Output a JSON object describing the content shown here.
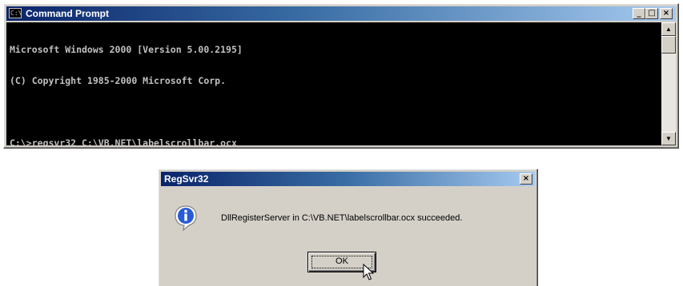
{
  "cmd_window": {
    "title": "Command Prompt",
    "title_icon_text": "C:\\",
    "buttons": {
      "minimize": "_",
      "maximize": "□",
      "close": "×"
    },
    "console_lines": [
      "Microsoft Windows 2000 [Version 5.00.2195]",
      "(C) Copyright 1985-2000 Microsoft Corp.",
      "",
      "C:\\>regsvr32 C:\\VB.NET\\labelscrollbar.ocx"
    ],
    "scrollbar": {
      "up_arrow": "▲",
      "down_arrow": "▼"
    },
    "colors": {
      "console_bg": "#000000",
      "console_text": "#c0c0c0",
      "title_active": "#0a246a"
    }
  },
  "dialog": {
    "title": "RegSvr32",
    "close_glyph": "×",
    "icon": "information-icon",
    "message": "DllRegisterServer in C:\\VB.NET\\labelscrollbar.ocx succeeded.",
    "ok_label": "OK"
  },
  "cursor": {
    "icon": "arrow-pointer-icon"
  }
}
